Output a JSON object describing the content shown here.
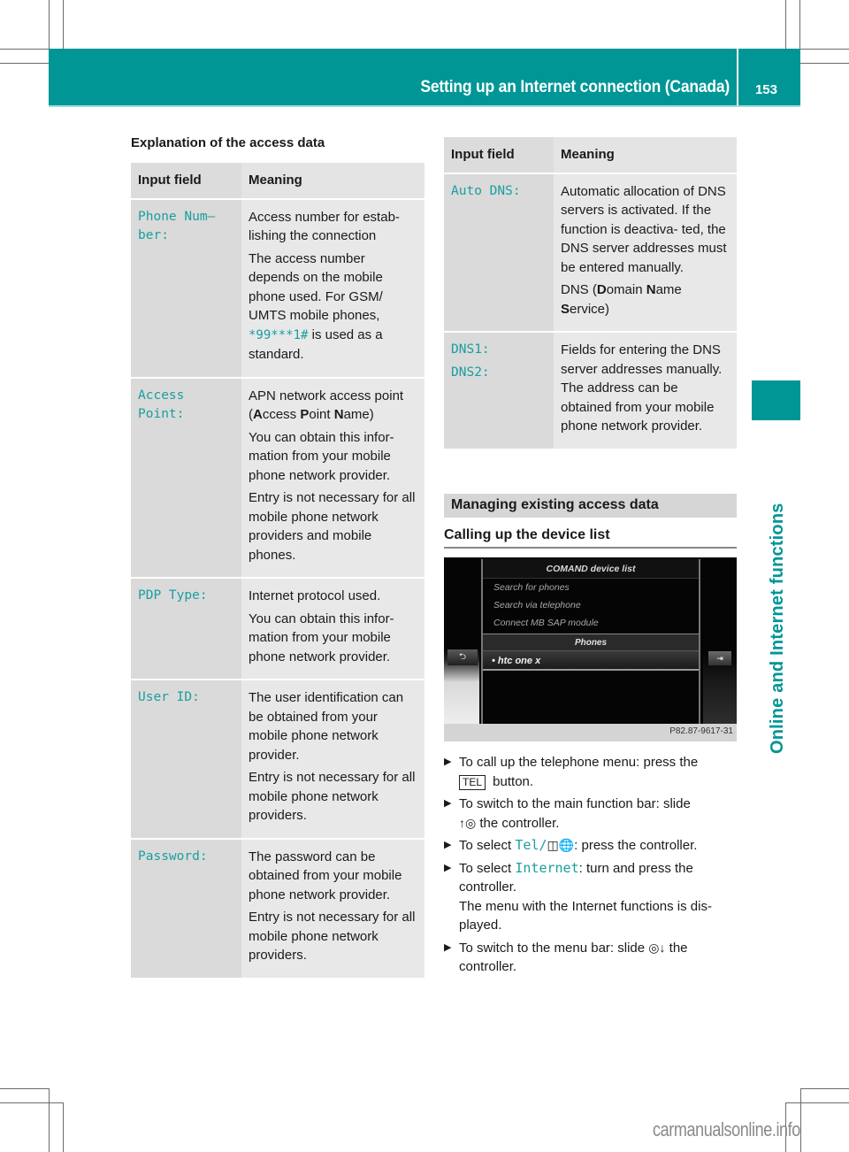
{
  "header": {
    "title": "Setting up an Internet connection (Canada)",
    "page_number": "153",
    "accent_color": "#009696"
  },
  "side_tab": {
    "label": "Online and Internet functions"
  },
  "left": {
    "section_title": "Explanation of the access data",
    "table": {
      "headers": [
        "Input field",
        "Meaning"
      ],
      "rows": [
        {
          "field": "Phone Num- ber:",
          "paragraphs": [
            "Access number for estab- lishing the connection",
            "The access number depends on the mobile phone used. For GSM/ UMTS mobile phones,"
          ],
          "code": "*99***1#",
          "code_suffix": " is used as a standard."
        },
        {
          "field": "Access Point:",
          "apn_prefix": "APN network access point (",
          "apn_A": "A",
          "apn_ccess": "ccess ",
          "apn_P": "P",
          "apn_oint": "oint ",
          "apn_N": "N",
          "apn_ame": "ame)",
          "paragraphs": [
            "You can obtain this infor- mation from your mobile phone network provider.",
            "Entry is not necessary for all mobile phone network providers and mobile phones."
          ]
        },
        {
          "field": "PDP Type:",
          "paragraphs": [
            "Internet protocol used.",
            "You can obtain this infor- mation from your mobile phone network provider."
          ]
        },
        {
          "field": "User ID:",
          "paragraphs": [
            "The user identification can be obtained from your mobile phone network provider.",
            "Entry is not necessary for all mobile phone network providers."
          ]
        },
        {
          "field": "Password:",
          "paragraphs": [
            "The password can be obtained from your mobile phone network provider.",
            "Entry is not necessary for all mobile phone network providers."
          ]
        }
      ]
    }
  },
  "right": {
    "table": {
      "headers": [
        "Input field",
        "Meaning"
      ],
      "rows": [
        {
          "field": "Auto DNS:",
          "paragraphs": [
            "Automatic allocation of DNS servers is activated. If the function is deactiva- ted, the DNS server addresses must be entered manually."
          ],
          "dns_prefix": "DNS (",
          "dns_D": "D",
          "dns_omain": "omain ",
          "dns_N": "N",
          "dns_ame": "ame ",
          "dns_S": "S",
          "dns_ervice": "ervice)"
        },
        {
          "field": "DNS1:",
          "field2": "DNS2:",
          "paragraphs": [
            "Fields for entering the DNS server addresses manually. The address can be obtained from your mobile phone network provider."
          ]
        }
      ]
    },
    "subsection_title": "Managing existing access data",
    "subheading": "Calling up the device list",
    "screenshot": {
      "title": "COMAND device list",
      "menu_items": [
        "Search for phones",
        "Search via telephone",
        "Connect MB SAP module"
      ],
      "group_label": "Phones",
      "selected_phone": "• htc one x",
      "back_icon": "⮌",
      "forward_icon": "⇥",
      "caption": "P82.87-9617-31"
    },
    "steps": [
      {
        "text_before": "To call up the telephone menu: press the ",
        "key": "TEL",
        "text_after": " button."
      },
      {
        "text_before": "To switch to the main function bar: slide ",
        "control": "↑◎",
        "text_after": " the controller."
      },
      {
        "text_before": "To select ",
        "code": "Tel/",
        "icon": "◫🌐",
        "text_after": ": press the controller."
      },
      {
        "text_before": "To select ",
        "code": "Internet",
        "text_after": ": turn and press the controller.",
        "note": "The menu with the Internet functions is dis- played."
      },
      {
        "text_before": "To switch to the menu bar: slide ",
        "control": "◎↓",
        "text_after": " the controller."
      }
    ]
  },
  "watermark": "carmanualsonline.info"
}
